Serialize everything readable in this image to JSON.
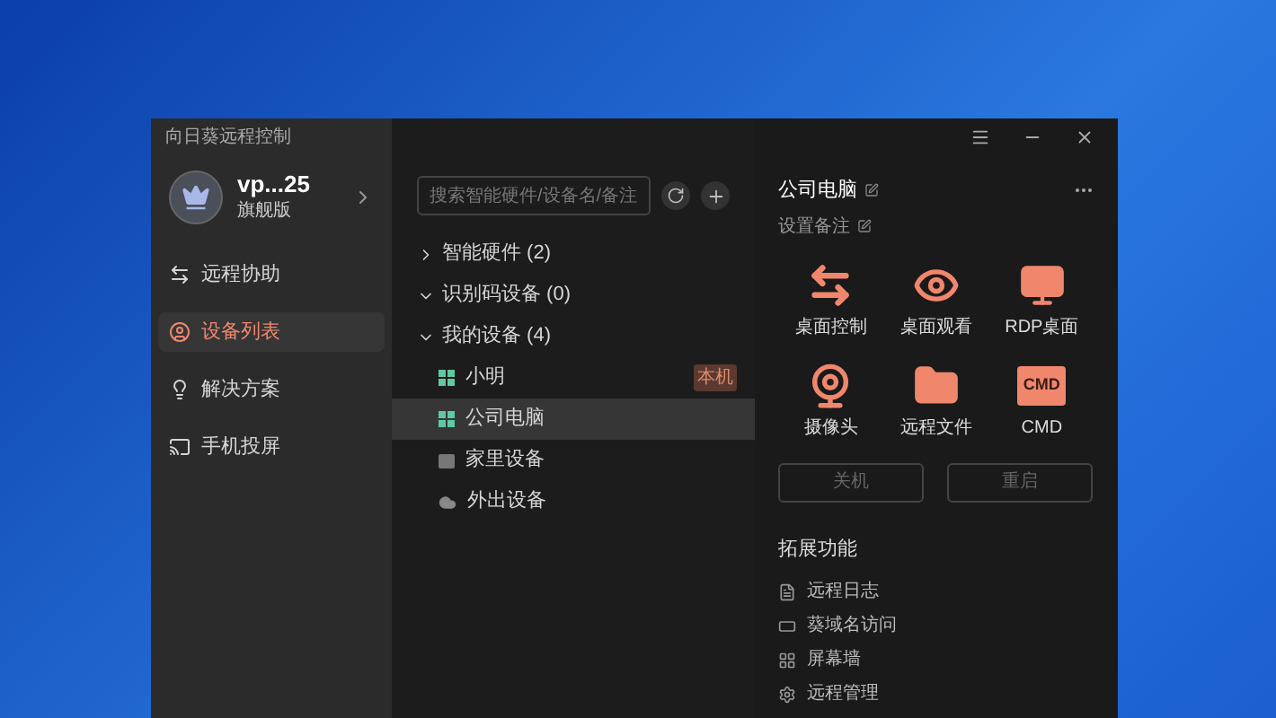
{
  "window": {
    "title": "向日葵远程控制"
  },
  "account": {
    "name": "vp...25",
    "plan": "旗舰版"
  },
  "sidebar": {
    "items": [
      {
        "label": "远程协助",
        "kind": "assist",
        "selected": false
      },
      {
        "label": "设备列表",
        "kind": "devices",
        "selected": true
      },
      {
        "label": "解决方案",
        "kind": "solutions",
        "selected": false
      },
      {
        "label": "手机投屏",
        "kind": "cast",
        "selected": false
      }
    ]
  },
  "search": {
    "placeholder": "搜索智能硬件/设备名/备注"
  },
  "groups": [
    {
      "label": "智能硬件 (2)",
      "expanded": false
    },
    {
      "label": "识别码设备 (0)",
      "expanded": true
    },
    {
      "label": "我的设备 (4)",
      "expanded": true,
      "children": [
        {
          "label": "小明",
          "kind": "online",
          "selected": false,
          "badge": "本机"
        },
        {
          "label": "公司电脑",
          "kind": "online",
          "selected": true
        },
        {
          "label": "家里设备",
          "kind": "offline",
          "selected": false
        },
        {
          "label": "外出设备",
          "kind": "cloud",
          "selected": false
        }
      ]
    }
  ],
  "detail": {
    "title": "公司电脑",
    "note": "设置备注",
    "actions": [
      {
        "label": "桌面控制",
        "kind": "control"
      },
      {
        "label": "桌面观看",
        "kind": "view"
      },
      {
        "label": "RDP桌面",
        "kind": "rdp"
      },
      {
        "label": "摄像头",
        "kind": "camera"
      },
      {
        "label": "远程文件",
        "kind": "files"
      },
      {
        "label": "CMD",
        "kind": "cmd",
        "icon_text": "CMD"
      }
    ],
    "buttons": [
      {
        "label": "关机",
        "disabled": true
      },
      {
        "label": "重启",
        "disabled": true
      }
    ],
    "extensions_title": "拓展功能",
    "extensions": [
      {
        "label": "远程日志",
        "kind": "log"
      },
      {
        "label": "葵域名访问",
        "kind": "domain"
      },
      {
        "label": "屏幕墙",
        "kind": "wall"
      },
      {
        "label": "远程管理",
        "kind": "manage"
      }
    ]
  }
}
